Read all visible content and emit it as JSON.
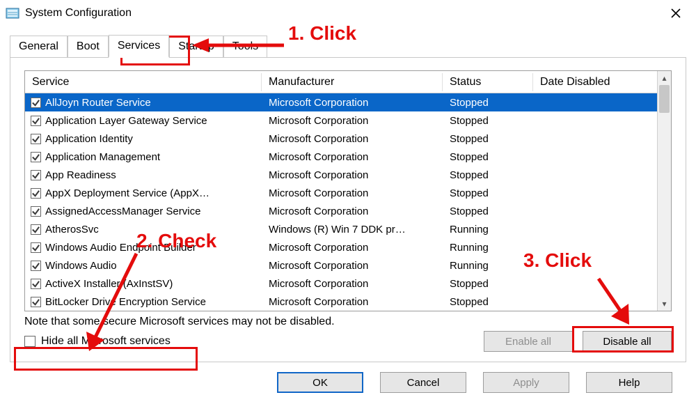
{
  "window": {
    "title": "System Configuration",
    "close_icon": "×"
  },
  "tabs": [
    {
      "label": "General"
    },
    {
      "label": "Boot"
    },
    {
      "label": "Services",
      "active": true
    },
    {
      "label": "Startup"
    },
    {
      "label": "Tools"
    }
  ],
  "columns": {
    "service": "Service",
    "manufacturer": "Manufacturer",
    "status": "Status",
    "date_disabled": "Date Disabled"
  },
  "services": [
    {
      "checked": true,
      "selected": true,
      "name": "AllJoyn Router Service",
      "mfr": "Microsoft Corporation",
      "status": "Stopped",
      "date": ""
    },
    {
      "checked": true,
      "name": "Application Layer Gateway Service",
      "mfr": "Microsoft Corporation",
      "status": "Stopped",
      "date": ""
    },
    {
      "checked": true,
      "name": "Application Identity",
      "mfr": "Microsoft Corporation",
      "status": "Stopped",
      "date": ""
    },
    {
      "checked": true,
      "name": "Application Management",
      "mfr": "Microsoft Corporation",
      "status": "Stopped",
      "date": ""
    },
    {
      "checked": true,
      "name": "App Readiness",
      "mfr": "Microsoft Corporation",
      "status": "Stopped",
      "date": ""
    },
    {
      "checked": true,
      "name": "AppX Deployment Service (AppX…",
      "mfr": "Microsoft Corporation",
      "status": "Stopped",
      "date": ""
    },
    {
      "checked": true,
      "name": "AssignedAccessManager Service",
      "mfr": "Microsoft Corporation",
      "status": "Stopped",
      "date": ""
    },
    {
      "checked": true,
      "name": "AtherosSvc",
      "mfr": "Windows (R) Win 7 DDK pr…",
      "status": "Running",
      "date": ""
    },
    {
      "checked": true,
      "name": "Windows Audio Endpoint Builder",
      "mfr": "Microsoft Corporation",
      "status": "Running",
      "date": ""
    },
    {
      "checked": true,
      "name": "Windows Audio",
      "mfr": "Microsoft Corporation",
      "status": "Running",
      "date": ""
    },
    {
      "checked": true,
      "name": "ActiveX Installer (AxInstSV)",
      "mfr": "Microsoft Corporation",
      "status": "Stopped",
      "date": ""
    },
    {
      "checked": true,
      "name": "BitLocker Drive Encryption Service",
      "mfr": "Microsoft Corporation",
      "status": "Stopped",
      "date": ""
    }
  ],
  "note": "Note that some secure Microsoft services may not be disabled.",
  "hide_ms": {
    "checked": false,
    "label": "Hide all Microsoft services"
  },
  "buttons": {
    "enable_all": "Enable all",
    "disable_all": "Disable all",
    "ok": "OK",
    "cancel": "Cancel",
    "apply": "Apply",
    "help": "Help"
  },
  "annotations": {
    "one": "1. Click",
    "two": "2. Check",
    "three": "3. Click"
  }
}
